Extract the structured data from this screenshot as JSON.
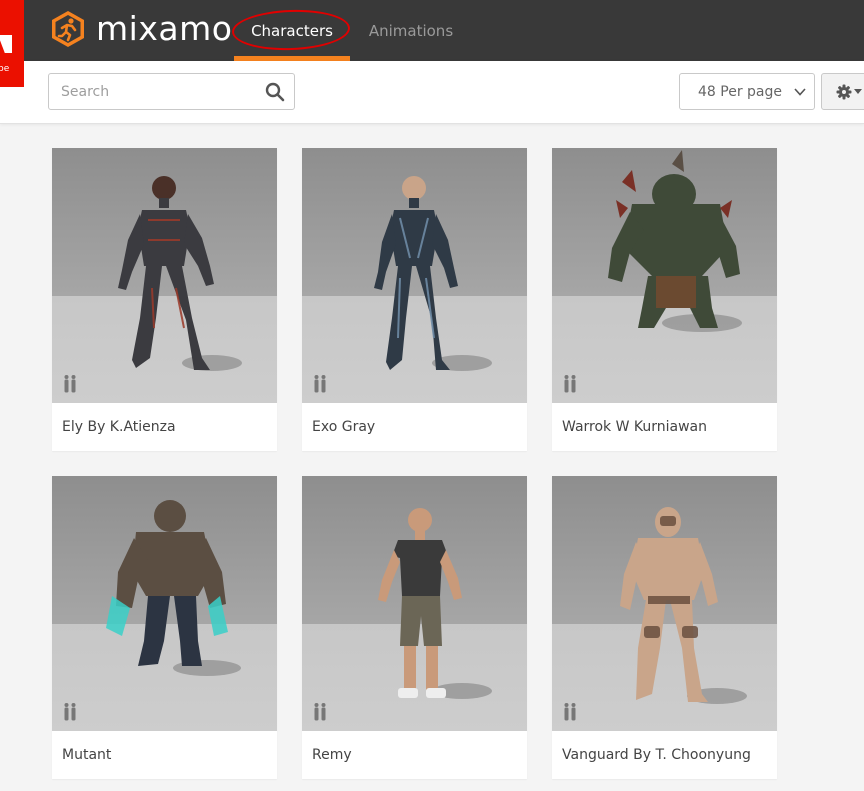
{
  "adobe": {
    "label": "be"
  },
  "brand": {
    "name": "mixamo"
  },
  "nav": {
    "tabs": [
      {
        "label": "Characters",
        "active": true
      },
      {
        "label": "Animations",
        "active": false
      }
    ]
  },
  "toolbar": {
    "search_placeholder": "Search",
    "per_page": "48 Per page"
  },
  "characters": [
    {
      "name": "Ely By K.Atienza"
    },
    {
      "name": "Exo Gray"
    },
    {
      "name": "Warrok W Kurniawan"
    },
    {
      "name": "Mutant"
    },
    {
      "name": "Remy"
    },
    {
      "name": "Vanguard By T. Choonyung"
    }
  ],
  "colors": {
    "navbar": "#393939",
    "accent": "#f5821f",
    "annotation": "#e10000",
    "adobe_red": "#eb1000"
  },
  "icons": [
    "search-icon",
    "chevron-down-icon",
    "gear-icon",
    "two-figures-icon",
    "running-man-logo"
  ]
}
